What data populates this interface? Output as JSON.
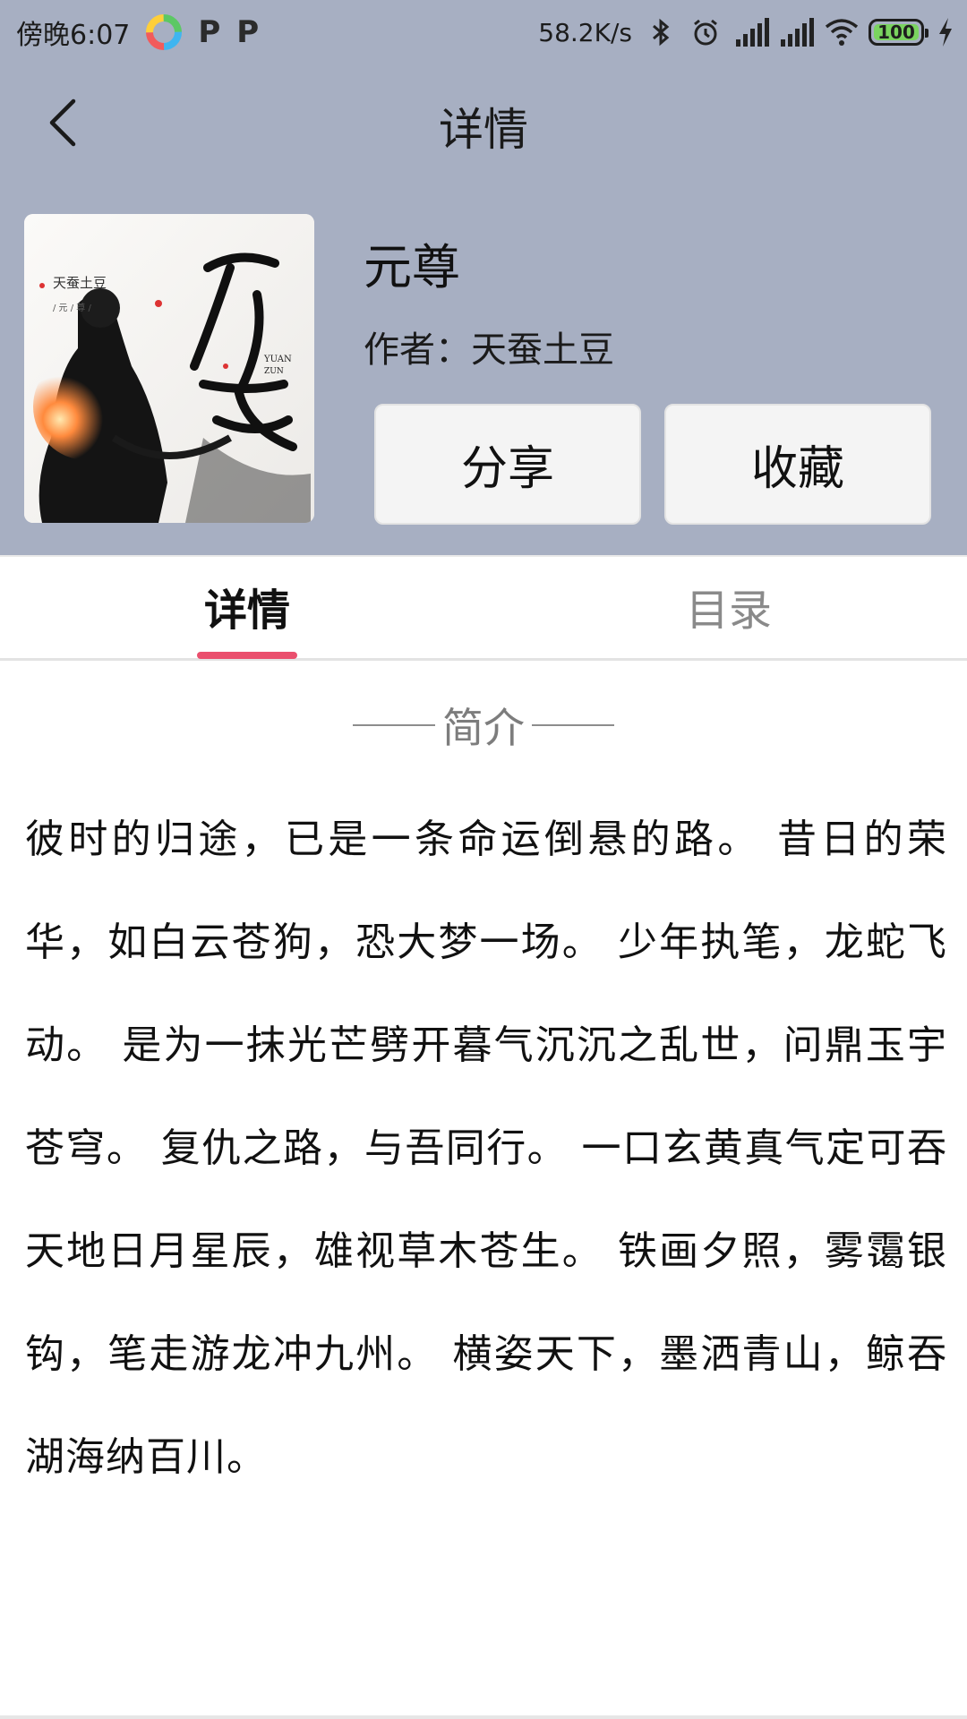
{
  "status_bar": {
    "time": "傍晚6:07",
    "network_speed": "58.2K/s",
    "battery": "100",
    "app_icons": [
      "colorful-app-icon",
      "p-icon",
      "p-icon"
    ],
    "p_glyph": "P",
    "system_icons": [
      "bluetooth-icon",
      "alarm-icon",
      "signal-icon",
      "signal-icon",
      "wifi-icon",
      "battery-icon",
      "charging-icon"
    ]
  },
  "header": {
    "title": "详情",
    "back_icon": "chevron-left-icon"
  },
  "book": {
    "title": "元尊",
    "author": "作者：天蚕土豆",
    "cover_text": {
      "publisher_label": "天蚕土豆",
      "small_caption": "/ 元 / 尊 /",
      "calligraphy": "元尊",
      "pinyin_1": "YUAN",
      "pinyin_2": "ZUN"
    }
  },
  "actions": {
    "share_label": "分享",
    "favorite_label": "收藏"
  },
  "tabs": {
    "items": [
      {
        "label": "详情",
        "active": true
      },
      {
        "label": "目录",
        "active": false
      }
    ]
  },
  "intro": {
    "heading": "简介",
    "text": "彼时的归途，已是一条命运倒悬的路。 昔日的荣华，如白云苍狗，恐大梦一场。 少年执笔，龙蛇飞动。 是为一抹光芒劈开暮气沉沉之乱世，问鼎玉宇苍穹。 复仇之路，与吾同行。 一口玄黄真气定可吞天地日月星辰，雄视草木苍生。 铁画夕照，雾霭银钩，笔走游龙冲九州。 横姿天下，墨洒青山，鲸吞湖海纳百川。"
  },
  "colors": {
    "header_bg": "#a7afc2",
    "tab_indicator": "#ea4f6d",
    "inactive_tab": "#8a8a8a",
    "battery_fill": "#7ad45f"
  }
}
